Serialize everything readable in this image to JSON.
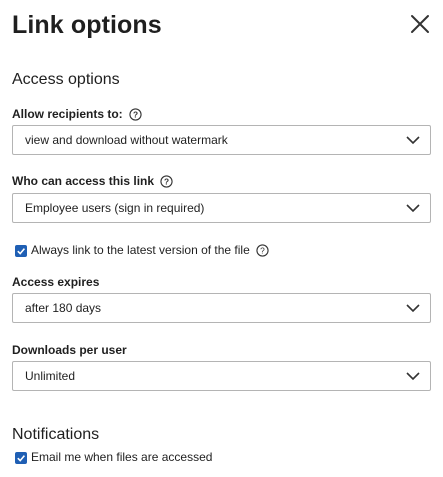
{
  "dialog": {
    "title": "Link options",
    "close_icon": "close-icon"
  },
  "access": {
    "heading": "Access options",
    "allow_recipients": {
      "label": "Allow recipients to:",
      "value": "view and download without watermark"
    },
    "who_can_access": {
      "label": "Who can access this link",
      "value": "Employee users (sign in required)"
    },
    "latest_version": {
      "label": "Always link to the latest version of the file",
      "checked": true
    },
    "access_expires": {
      "label": "Access expires",
      "value": "after 180 days"
    },
    "downloads_per_user": {
      "label": "Downloads per user",
      "value": "Unlimited"
    }
  },
  "notifications": {
    "heading": "Notifications",
    "email_me": {
      "label": "Email me when files are accessed",
      "checked": true
    }
  },
  "colors": {
    "accent": "#1f5fb4",
    "border": "#b4b4b4",
    "text": "#1f1f1f"
  }
}
